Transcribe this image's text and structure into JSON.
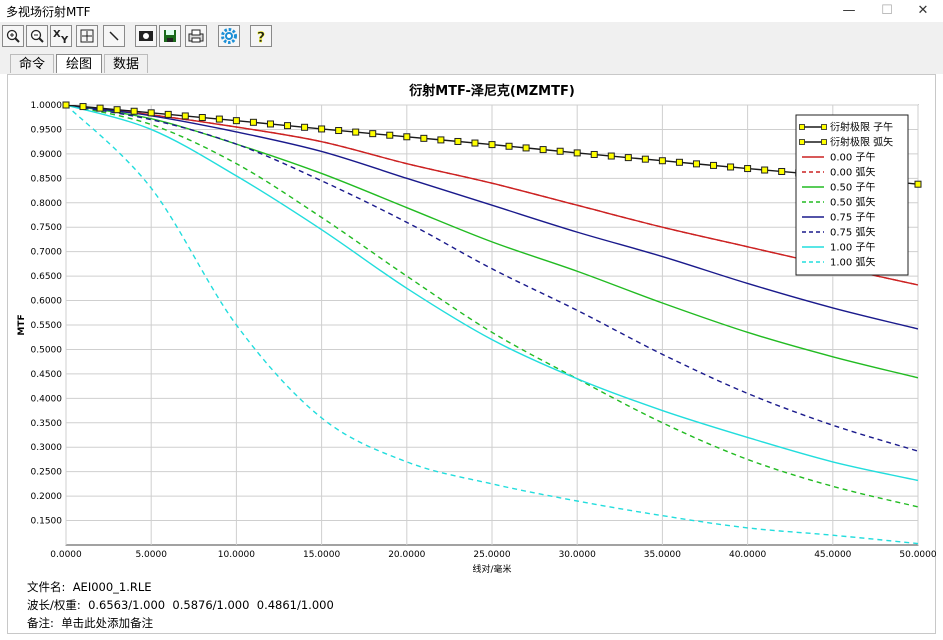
{
  "window": {
    "title": "多视场衍射MTF"
  },
  "tabs": [
    {
      "label": "命令"
    },
    {
      "label": "绘图"
    },
    {
      "label": "数据"
    }
  ],
  "toolbar_icons": [
    "zoom-in",
    "zoom-out",
    "axes-xy",
    "fit-window",
    "pen",
    "camera",
    "save",
    "print",
    "settings",
    "help"
  ],
  "colors": {
    "limit": "#1a1a1a",
    "limit_marker": "#ffff00",
    "f000": "#cc2222",
    "f050": "#22bb22",
    "f075": "#1a1a8c",
    "f100": "#22dddd"
  },
  "chart_data": {
    "type": "line",
    "title": "衍射MTF-泽尼克(MZMTF)",
    "xlabel": "线对/毫米",
    "ylabel": "MTF",
    "xlim": [
      0,
      50
    ],
    "ylim": [
      0.1,
      1.0
    ],
    "x_ticks": [
      "0.0000",
      "5.0000",
      "10.0000",
      "15.0000",
      "20.0000",
      "25.0000",
      "30.0000",
      "35.0000",
      "40.0000",
      "45.0000",
      "50.0000"
    ],
    "y_ticks": [
      "1.0000",
      "0.9500",
      "0.9000",
      "0.8500",
      "0.8000",
      "0.7500",
      "0.7000",
      "0.6500",
      "0.6000",
      "0.5500",
      "0.5000",
      "0.4500",
      "0.4000",
      "0.3500",
      "0.3000",
      "0.2500",
      "0.2000",
      "0.1500"
    ],
    "legend_position": "top-right",
    "x": [
      0,
      5,
      10,
      15,
      20,
      25,
      30,
      35,
      40,
      45,
      50
    ],
    "series": [
      {
        "name": "衍射极限 子午",
        "style": "marker",
        "color": "#1a1a1a",
        "values": [
          1.0,
          0.984,
          0.968,
          0.951,
          0.935,
          0.919,
          0.902,
          0.886,
          0.87,
          0.855,
          0.838
        ]
      },
      {
        "name": "衍射极限 弧矢",
        "style": "marker",
        "color": "#1a1a1a",
        "values": [
          1.0,
          0.984,
          0.968,
          0.951,
          0.935,
          0.919,
          0.902,
          0.886,
          0.87,
          0.855,
          0.838
        ]
      },
      {
        "name": "0.00 子午",
        "style": "solid",
        "color": "#cc2222",
        "values": [
          1.0,
          0.98,
          0.955,
          0.925,
          0.88,
          0.84,
          0.795,
          0.75,
          0.71,
          0.67,
          0.632
        ]
      },
      {
        "name": "0.00 弧矢",
        "style": "dashed",
        "color": "#cc2222",
        "values": [
          1.0,
          0.98,
          0.955,
          0.925,
          0.88,
          0.84,
          0.795,
          0.75,
          0.71,
          0.67,
          0.632
        ]
      },
      {
        "name": "0.50 子午",
        "style": "solid",
        "color": "#22bb22",
        "values": [
          1.0,
          0.972,
          0.92,
          0.86,
          0.79,
          0.72,
          0.66,
          0.595,
          0.535,
          0.485,
          0.442
        ]
      },
      {
        "name": "0.50 弧矢",
        "style": "dashed",
        "color": "#22bb22",
        "values": [
          1.0,
          0.96,
          0.88,
          0.77,
          0.65,
          0.535,
          0.44,
          0.35,
          0.275,
          0.22,
          0.178
        ]
      },
      {
        "name": "0.75 子午",
        "style": "solid",
        "color": "#1a1a8c",
        "values": [
          1.0,
          0.978,
          0.945,
          0.905,
          0.85,
          0.795,
          0.74,
          0.69,
          0.635,
          0.585,
          0.542
        ]
      },
      {
        "name": "0.75 弧矢",
        "style": "dashed",
        "color": "#1a1a8c",
        "values": [
          1.0,
          0.97,
          0.92,
          0.845,
          0.76,
          0.665,
          0.58,
          0.49,
          0.41,
          0.345,
          0.292
        ]
      },
      {
        "name": "1.00 子午",
        "style": "solid",
        "color": "#22dddd",
        "values": [
          1.0,
          0.95,
          0.855,
          0.745,
          0.625,
          0.52,
          0.44,
          0.375,
          0.32,
          0.27,
          0.232
        ]
      },
      {
        "name": "1.00 弧矢",
        "style": "dashed",
        "color": "#22dddd",
        "values": [
          1.0,
          0.83,
          0.55,
          0.36,
          0.27,
          0.225,
          0.19,
          0.16,
          0.135,
          0.12,
          0.103
        ]
      }
    ]
  },
  "footer": {
    "file_label": "文件名:",
    "file_value": "AEI000_1.RLE",
    "wave_label": "波长/权重:",
    "wave_value": "0.6563/1.000  0.5876/1.000  0.4861/1.000",
    "note_label": "备注:",
    "note_value": "单击此处添加备注"
  }
}
